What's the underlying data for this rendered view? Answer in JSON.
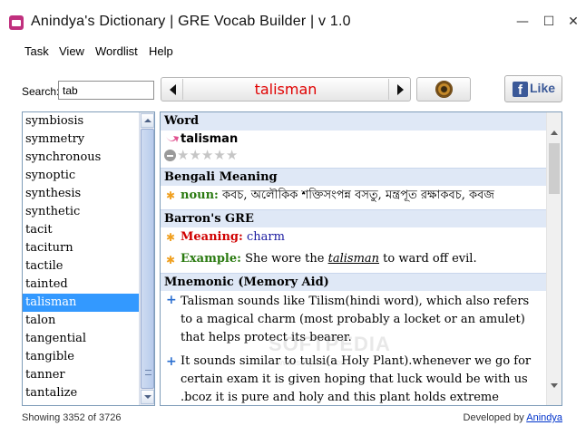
{
  "window": {
    "title": "Anindya's Dictionary | GRE Vocab Builder | v 1.0",
    "controls": {
      "minimize": "—",
      "maximize": "☐",
      "close": "✕"
    }
  },
  "menu": [
    "Task",
    "View",
    "Wordlist",
    "Help"
  ],
  "search": {
    "label": "Search:",
    "value": "tab"
  },
  "nav": {
    "current_word": "talisman"
  },
  "facebook": {
    "f": "f",
    "like": "Like"
  },
  "wordlist": {
    "items": [
      "symbiosis",
      "symmetry",
      "synchronous",
      "synoptic",
      "synthesis",
      "synthetic",
      "tacit",
      "taciturn",
      "tactile",
      "tainted",
      "talisman",
      "talon",
      "tangential",
      "tangible",
      "tanner",
      "tantalize"
    ],
    "selected_index": 10
  },
  "entry": {
    "sections": {
      "word": "Word",
      "bengali": "Bengali Meaning",
      "barrons": "Barron's GRE",
      "mnemonic": "Mnemonic (Memory Aid)"
    },
    "word": "talisman",
    "rating": {
      "stars": 5,
      "filled": 0
    },
    "bengali": {
      "pos": "noun:",
      "meaning": "কবচ, অলৌকিক শক্তিসংপন্ন বসতু, মন্ত্রপূত রক্ষাকবচ, কবজ"
    },
    "barrons": {
      "meaning_label": "Meaning:",
      "meaning": "charm",
      "example_label": "Example:",
      "example_before": "She wore the ",
      "example_word": "talisman",
      "example_after": " to ward off evil."
    },
    "mnemonics": [
      "Talisman sounds like Tilism(hindi word), which also refers to a magical charm (most probably a locket or an amulet) that helps protect its bearer.",
      "It sounds similar to tulsi(a Holy Plant).whenever we go for certain exam it is given hoping that luck would be with us .bcoz it is pure and holy and this plant holds extreme"
    ]
  },
  "watermark": {
    "main": "SOFTPEDIA",
    "sub": "www.softpedia.com"
  },
  "status": {
    "showing": "Showing 3352 of 3726",
    "developed_by": "Developed by ",
    "author": "Anindya"
  },
  "colors": {
    "nav_word": "#e00000",
    "selection": "#3399ff",
    "section_header": "#dfe8f6",
    "facebook": "#3b5998",
    "meaning_label": "#d00000",
    "meaning_value": "#1a1aa0",
    "green_label": "#2a7a10",
    "link": "#0033cc"
  }
}
